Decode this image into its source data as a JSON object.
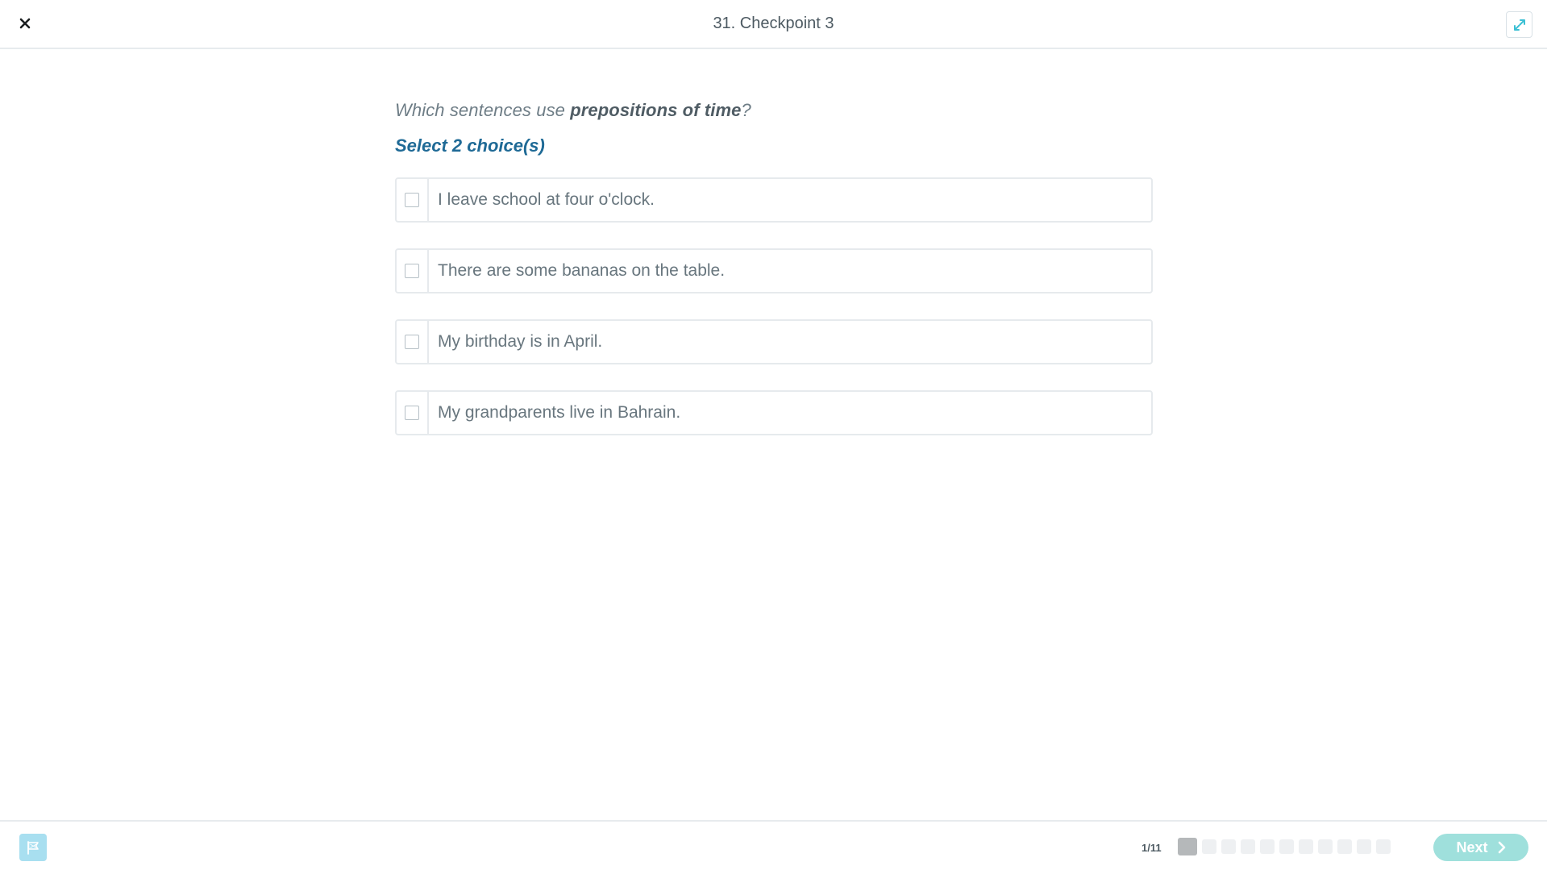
{
  "header": {
    "title": "31. Checkpoint 3",
    "close_icon": "close-icon",
    "expand_icon": "expand-icon"
  },
  "question": {
    "prefix": "Which sentences use ",
    "emphasis": "prepositions of time",
    "suffix": "?",
    "instruction": "Select 2 choice(s)"
  },
  "options": [
    {
      "label": "I leave school at four o'clock."
    },
    {
      "label": "There are some bananas on the table."
    },
    {
      "label": "My birthday is in April."
    },
    {
      "label": "My grandparents live in Bahrain."
    }
  ],
  "footer": {
    "flag_icon": "flag-icon",
    "progress_label": "1/11",
    "progress_current": 1,
    "progress_total": 11,
    "next_label": "Next",
    "next_icon": "chevron-right-icon"
  },
  "colors": {
    "accent": "#1f6a96",
    "next_button": "#9fe0dc",
    "flag_button": "#a8dff0",
    "expand_icon": "#3cc0d4"
  }
}
